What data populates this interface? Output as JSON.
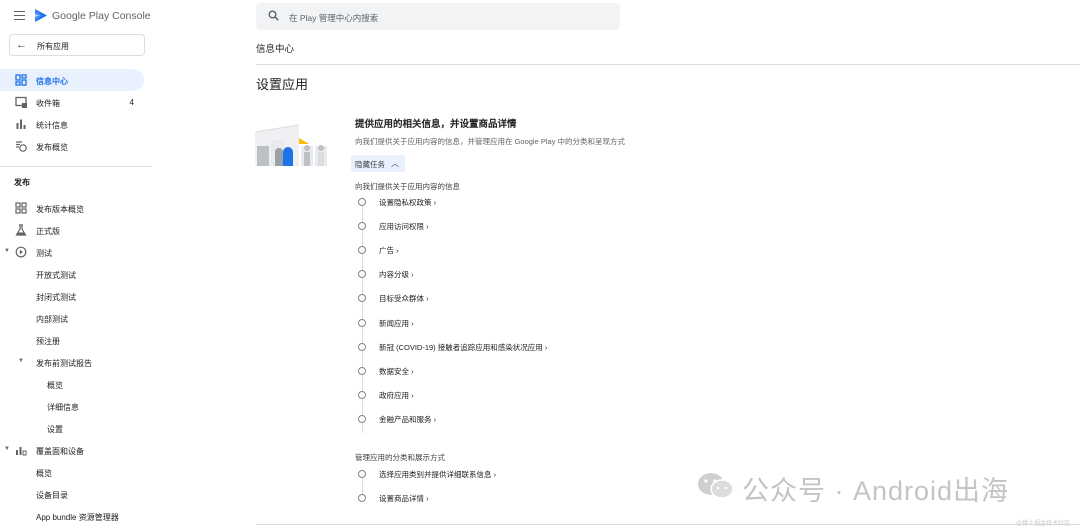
{
  "app": {
    "logo_text": "Google Play Console"
  },
  "sidebar": {
    "all_apps": "所有应用",
    "top_items": [
      {
        "label": "信息中心",
        "icon": "dashboard-icon",
        "active": true
      },
      {
        "label": "收件箱",
        "icon": "inbox-icon",
        "count": "4"
      },
      {
        "label": "统计信息",
        "icon": "bar-chart-icon"
      },
      {
        "label": "发布概览",
        "icon": "publishing-overview-icon"
      }
    ],
    "release_section": "发布",
    "release_items": [
      {
        "label": "发布版本概览",
        "icon": "releases-overview-icon"
      },
      {
        "label": "正式版",
        "icon": "production-icon"
      },
      {
        "label": "测试",
        "icon": "testing-icon"
      },
      {
        "label": "开放式测试"
      },
      {
        "label": "封闭式测试"
      },
      {
        "label": "内部测试"
      },
      {
        "label": "预注册"
      },
      {
        "label": "发布前测试报告"
      },
      {
        "label": "概览"
      },
      {
        "label": "详细信息"
      },
      {
        "label": "设置"
      },
      {
        "label": "覆盖面和设备",
        "icon": "reach-devices-icon"
      },
      {
        "label": "概览"
      },
      {
        "label": "设备目录"
      },
      {
        "label": "App bundle 资源管理器",
        "icon": "app-bundle-icon"
      }
    ]
  },
  "search": {
    "placeholder": "在 Play 管理中心内搜索"
  },
  "main": {
    "breadcrumb": "信息中心",
    "title": "设置应用",
    "card_title": "提供应用的相关信息，并设置商品详情",
    "card_subtitle": "向我们提供关于应用内容的信息，并管理应用在 Google Play 中的分类和呈现方式",
    "hide_tasks": "隐藏任务",
    "group1_label": "向我们提供关于应用内容的信息",
    "group1_tasks": [
      "设置隐私权政策 ›",
      "应用访问权限 ›",
      "广告 ›",
      "内容分级 ›",
      "目标受众群体 ›",
      "新闻应用 ›",
      "新冠 (COVID-19) 接触者追踪应用和感染状况应用 ›",
      "数据安全 ›",
      "政府应用 ›",
      "金融产品和服务 ›"
    ],
    "group2_label": "管理应用的分类和展示方式",
    "group2_tasks": [
      "选择应用类别并提供详细联系信息 ›",
      "设置商品详情 ›"
    ]
  },
  "watermark": {
    "text": "公众号 · Android出海",
    "small": "@稀土掘金技术社区"
  }
}
